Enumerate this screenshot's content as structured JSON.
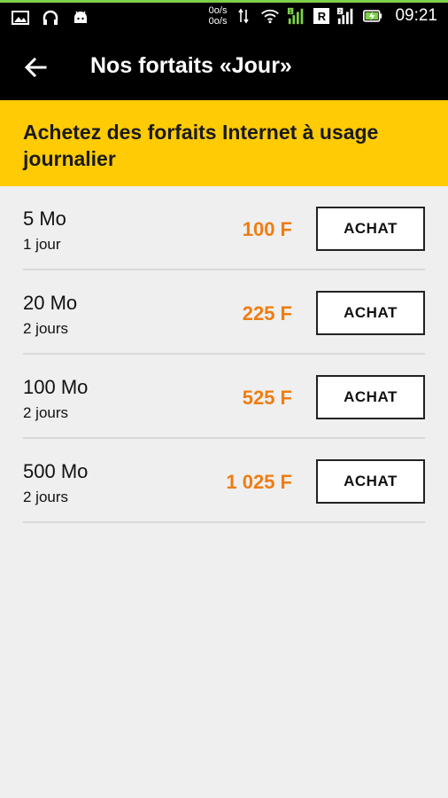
{
  "status_bar": {
    "speed_up": "0o/s",
    "speed_down": "0o/s",
    "sim1_label": "R",
    "sim2_label": "2",
    "time": "09:21",
    "accent_color": "#7fd14a"
  },
  "app_bar": {
    "title": "Nos fortaits «Jour»",
    "back_icon": "arrow-left-icon"
  },
  "banner": {
    "text": "Achetez des forfaits Internet à usage journalier",
    "color": "#ffcb05"
  },
  "plans": [
    {
      "size": "5 Mo",
      "duration": "1 jour",
      "price": "100 F",
      "button": "ACHAT"
    },
    {
      "size": "20 Mo",
      "duration": "2 jours",
      "price": "225 F",
      "button": "ACHAT"
    },
    {
      "size": "100 Mo",
      "duration": "2 jours",
      "price": "525 F",
      "button": "ACHAT"
    },
    {
      "size": "500 Mo",
      "duration": "2 jours",
      "price": "1 025 F",
      "button": "ACHAT"
    }
  ],
  "price_color": "#ee7d12"
}
